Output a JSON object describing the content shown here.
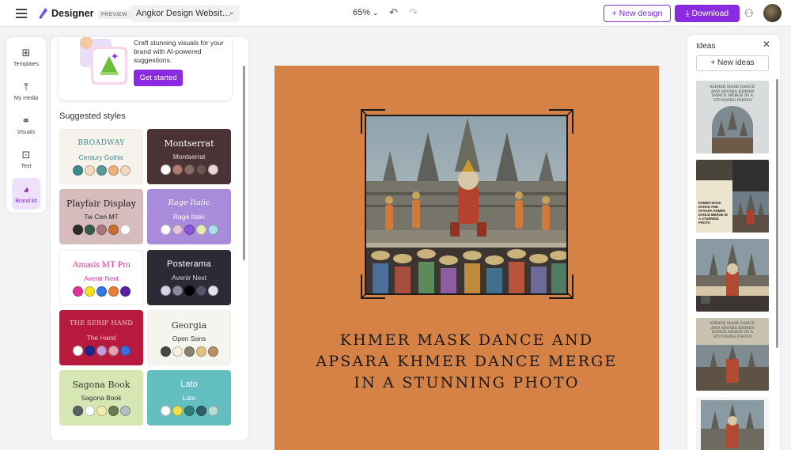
{
  "app": {
    "name": "Designer",
    "badge": "PREVIEW",
    "document_title": "Angkor Design Websit…",
    "zoom": "65%"
  },
  "toolbar": {
    "new_design_label": "New design",
    "download_label": "Download"
  },
  "rail": {
    "items": [
      {
        "label": "Templates",
        "icon": "templates-icon"
      },
      {
        "label": "My media",
        "icon": "upload-icon"
      },
      {
        "label": "Visuals",
        "icon": "visuals-icon"
      },
      {
        "label": "Text",
        "icon": "text-icon"
      },
      {
        "label": "Brand kit",
        "icon": "brand-kit-icon",
        "active": true
      }
    ]
  },
  "promo": {
    "text": "Craft stunning visuals for your brand with AI-powered suggestions.",
    "button_label": "Get started"
  },
  "styles": {
    "title": "Suggested styles",
    "cards": [
      {
        "heading": "BROADWAY",
        "body": "Century Gothic",
        "bg": "#f6f2ec",
        "heading_color": "#3a8a8a",
        "body_color": "#3a8a8a",
        "colors": [
          "#3f8a8b",
          "#f3d8bd",
          "#5a9a98",
          "#f0b079",
          "#f3d8bd"
        ]
      },
      {
        "heading": "Montserrat",
        "body": "Montserrat",
        "bg": "#4a3335",
        "heading_color": "#ffffff",
        "body_color": "#e9dada",
        "colors": [
          "#ffffff",
          "#b07d72",
          "#8a6c66",
          "#6a5553",
          "#e8d8d4"
        ]
      },
      {
        "heading": "Playfair Display",
        "body": "Tw Cen MT",
        "bg": "#d6bcbc",
        "heading_color": "#222222",
        "body_color": "#222222",
        "colors": [
          "#2d2d2d",
          "#3a5a4a",
          "#a6787a",
          "#c96f2e",
          "#ffffff"
        ]
      },
      {
        "heading": "Rage Italic",
        "body": "Rage Italic",
        "bg": "#a98bdc",
        "heading_color": "#ffffff",
        "body_color": "#ffffff",
        "colors": [
          "#ffffff",
          "#e3c6d6",
          "#8a55d8",
          "#e7ebb4",
          "#a7e0ea"
        ]
      },
      {
        "heading": "Amasis MT Pro",
        "body": "Avenir Next",
        "bg": "#ffffff",
        "heading_color": "#e0369a",
        "body_color": "#e0369a",
        "colors": [
          "#e0369a",
          "#f3e020",
          "#3476e3",
          "#ee7c3a",
          "#5a1fa3"
        ]
      },
      {
        "heading": "Posterama",
        "body": "Avenir Next",
        "bg": "#2d2a36",
        "heading_color": "#ffffff",
        "body_color": "#d8d8d8",
        "colors": [
          "#d6d3e6",
          "#8a8a98",
          "#000000",
          "#55556a",
          "#e2e2ea"
        ]
      },
      {
        "heading": "THE SERIF HAND",
        "body": "The Hand",
        "bg": "#b71a3c",
        "heading_color": "#f4c9d2",
        "body_color": "#f4c9d2",
        "colors": [
          "#ffffff",
          "#1e2a8a",
          "#c89ad6",
          "#e5a0b8",
          "#3a6fe0"
        ]
      },
      {
        "heading": "Georgia",
        "body": "Open Sans",
        "bg": "#f6f4ef",
        "heading_color": "#333333",
        "body_color": "#333333",
        "colors": [
          "#474747",
          "#f7f0dc",
          "#8a8468",
          "#dfc383",
          "#b89064"
        ]
      },
      {
        "heading": "Sagona Book",
        "body": "Sagona Book",
        "bg": "#d6e7b3",
        "heading_color": "#333333",
        "body_color": "#333333",
        "colors": [
          "#5a6266",
          "#ffffff",
          "#f5ecb0",
          "#6a7a55",
          "#aebfc4"
        ]
      },
      {
        "heading": "Lato",
        "body": "Lato",
        "bg": "#63bfbf",
        "heading_color": "#ffffff",
        "body_color": "#ffffff",
        "colors": [
          "#ffffff",
          "#f2e04a",
          "#2e7f7a",
          "#2f5e66",
          "#b9ddd6"
        ]
      }
    ]
  },
  "canvas": {
    "bg_color": "#d68246",
    "title": "KHMER MASK DANCE AND APSARA KHMER DANCE MERGE IN A STUNNING PHOTO"
  },
  "ideas": {
    "title": "Ideas",
    "new_ideas_label": "New ideas",
    "thumbs": [
      {
        "caption": "KHMER MASK DANCE AND APSARA KHMER DANCE MERGE IN A STUNNING PHOTO",
        "bg": "#d9dcdc"
      },
      {
        "caption": "KHMER MASK DANCE AND APSARA KHMER DANCE MERGE IN A STUNNING PHOTO",
        "bg": "#2f2f2f"
      },
      {
        "caption": "",
        "bg": "#6f7d86"
      },
      {
        "caption": "KHMER MASK DANCE AND APSARA KHMER DANCE MERGE IN A STUNNING PHOTO",
        "bg": "#c8c2b0"
      },
      {
        "caption": "",
        "bg": "#f4f4f4"
      }
    ]
  }
}
